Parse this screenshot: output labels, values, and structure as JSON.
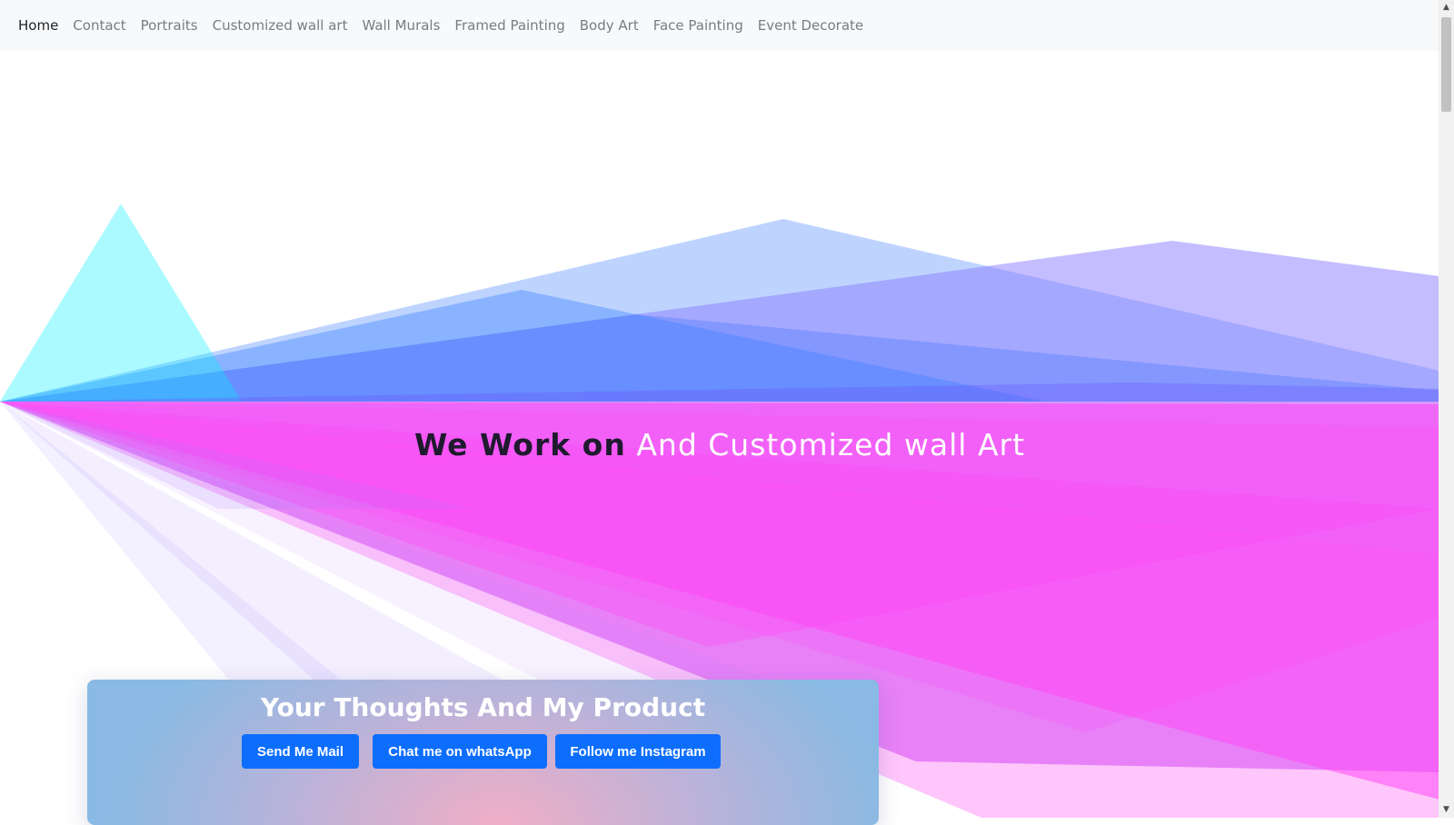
{
  "nav": {
    "items": [
      {
        "label": "Home",
        "active": true
      },
      {
        "label": "Contact",
        "active": false
      },
      {
        "label": "Portraits",
        "active": false
      },
      {
        "label": "Customized wall art",
        "active": false
      },
      {
        "label": "Wall Murals",
        "active": false
      },
      {
        "label": "Framed Painting",
        "active": false
      },
      {
        "label": "Body Art",
        "active": false
      },
      {
        "label": "Face Painting",
        "active": false
      },
      {
        "label": "Event Decorate",
        "active": false
      }
    ]
  },
  "hero": {
    "lead": "We Work on",
    "rotating_text": "And Customized wall Art"
  },
  "promo": {
    "title": "Your Thoughts And My Product",
    "buttons": {
      "mail": "Send Me Mail",
      "whatsapp": "Chat me on whatsApp",
      "instagram": "Follow me Instagram"
    }
  },
  "scrollbar": {
    "up_icon": "triangle-up-icon",
    "down_icon": "triangle-down-icon"
  },
  "colors": {
    "button": "#0d6efd",
    "navbar": "#f8f9fa",
    "cyan": "#00f0ff",
    "blue": "#3d7bff",
    "violet": "#8066ff",
    "magenta": "#ff3ef5"
  }
}
